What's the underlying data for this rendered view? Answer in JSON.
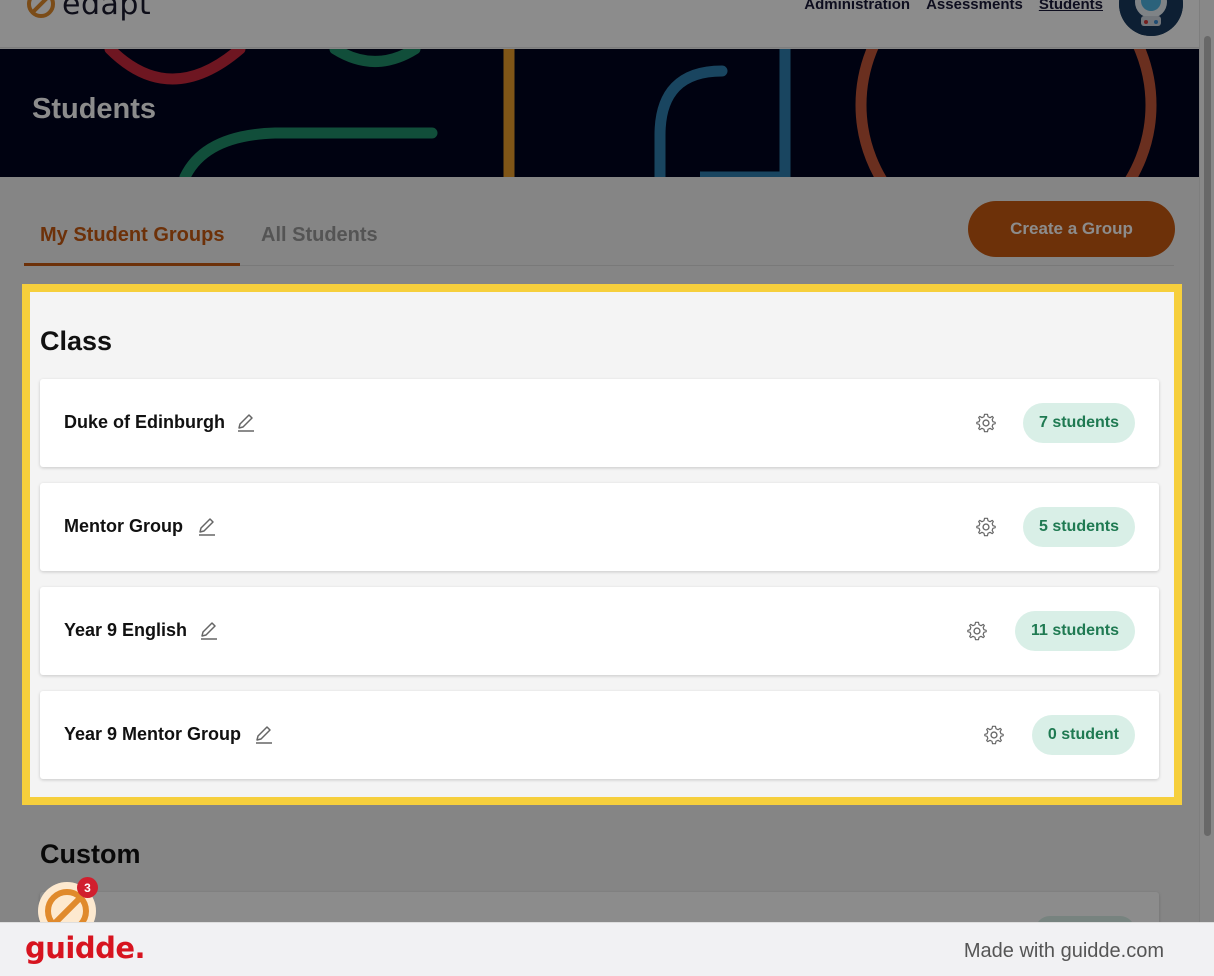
{
  "app": {
    "logo_text": "edapt",
    "nav": [
      "Administration",
      "Assessments",
      "Students"
    ],
    "active_nav": "Students"
  },
  "banner": {
    "title": "Students"
  },
  "tabs": [
    {
      "label": "My Student Groups",
      "active": true
    },
    {
      "label": "All Students",
      "active": false
    }
  ],
  "create_group_label": "Create a Group",
  "sections": {
    "class_title": "Class",
    "custom_title": "Custom"
  },
  "groups": [
    {
      "name": "Duke of Edinburgh",
      "count": "7 students"
    },
    {
      "name": "Mentor Group",
      "count": "5 students"
    },
    {
      "name": "Year 9 English",
      "count": "11 students"
    },
    {
      "name": "Year 9 Mentor Group",
      "count": "0 student"
    }
  ],
  "notification_count": "3",
  "footer": {
    "brand": "guidde.",
    "made_with": "Made with guidde.com"
  },
  "colors": {
    "accent": "#c75a12",
    "highlight": "#f6cf3c",
    "pill_bg": "#d9efe7",
    "pill_text": "#1f7a52",
    "banner_bg": "#01051f",
    "guidde_red": "#d7141f"
  }
}
